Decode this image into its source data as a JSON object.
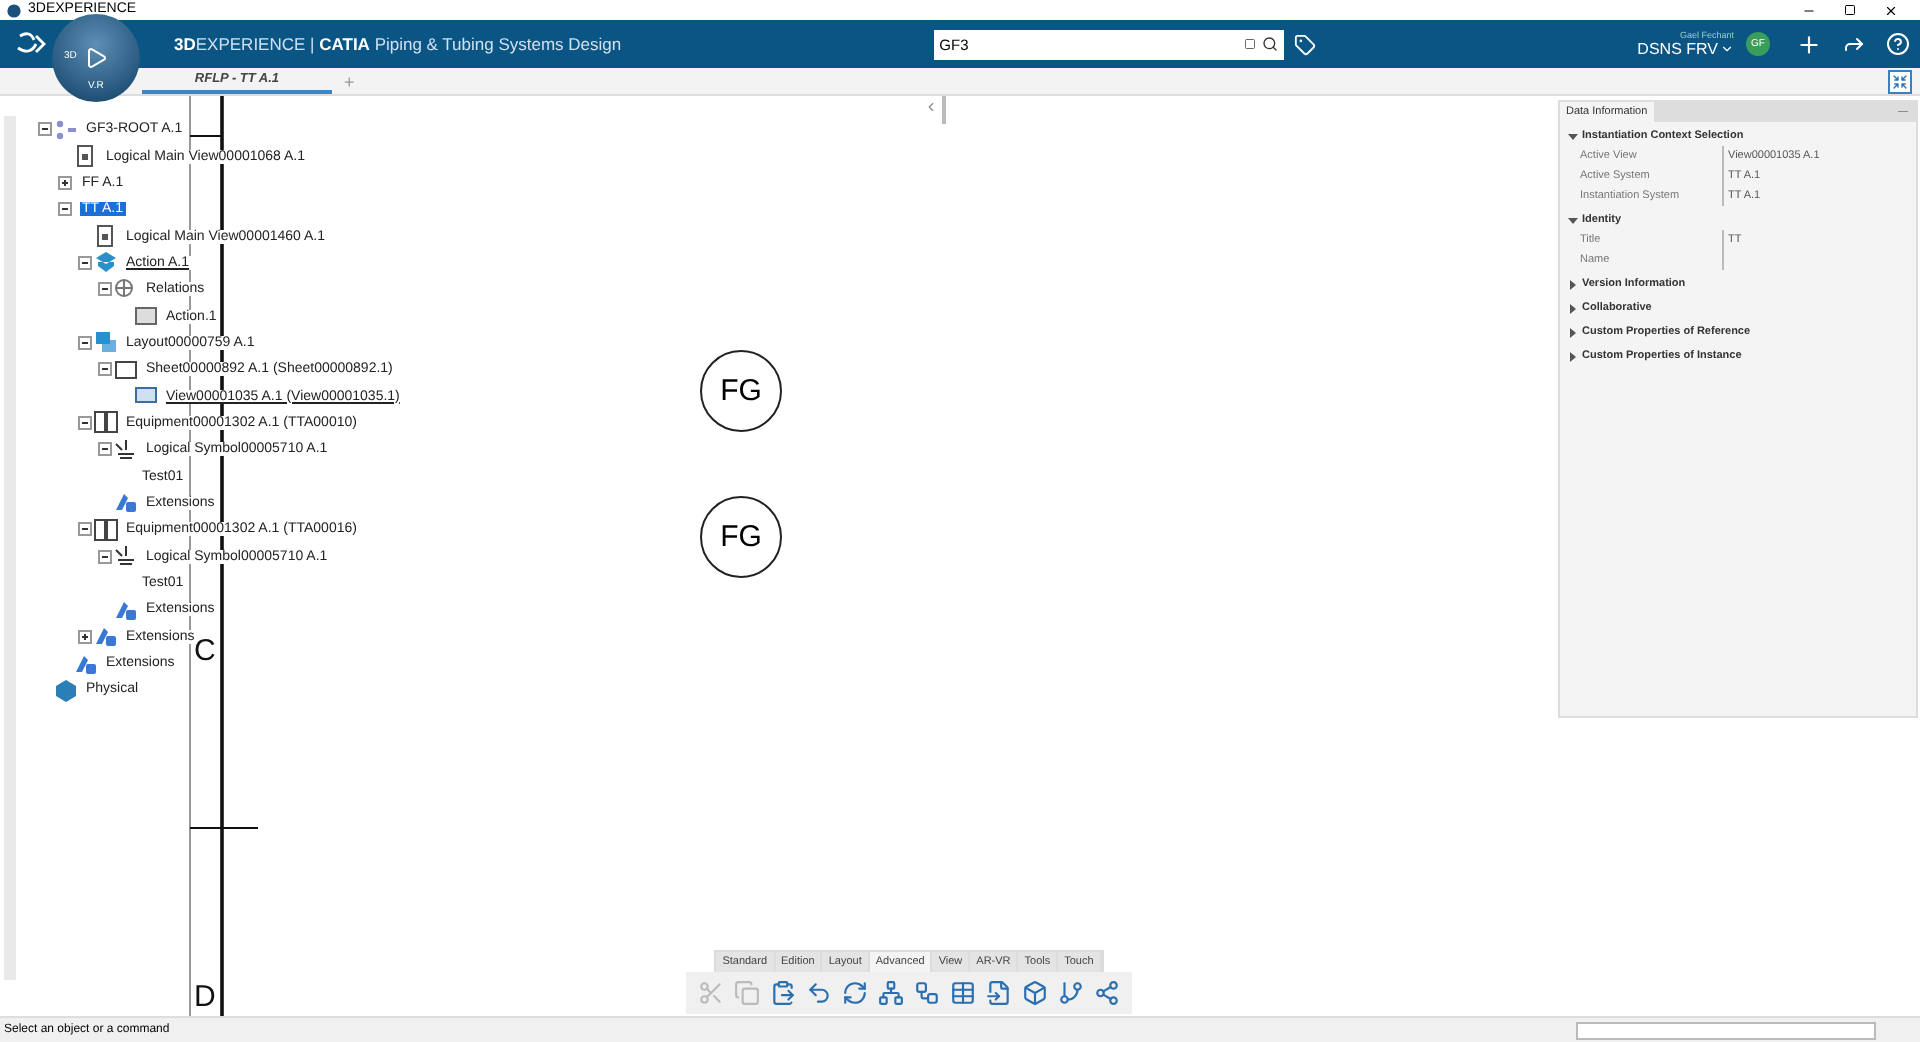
{
  "window": {
    "title": "3DEXPERIENCE"
  },
  "top_bar": {
    "compass": {
      "left": "3D",
      "bottom": "V.R"
    },
    "brand": "**3D**EXPERIENCE | **CATIA** Piping & Tubing Systems Design",
    "search": {
      "value": "GF3"
    },
    "user": {
      "name": "Gael Fechant",
      "tenant": "DSNS FRV",
      "initials": "GF"
    }
  },
  "tabs": [
    {
      "label": "RFLP - TT A.1",
      "selected": true
    }
  ],
  "add_tab": "+",
  "tree": [
    {
      "label": "GF3-ROOT A.1",
      "kind": "root",
      "selected": false,
      "underlined": false,
      "expanded": true,
      "children": [
        {
          "label": "Logical Main View00001068 A.1",
          "kind": "logical-view",
          "selected": false,
          "underlined": false
        },
        {
          "label": "FF A.1",
          "kind": "plain",
          "selected": false,
          "underlined": false,
          "expanded": false
        },
        {
          "label": "TT A.1",
          "kind": "plain",
          "selected": true,
          "underlined": false,
          "expanded": true,
          "children": [
            {
              "label": "Logical Main View00001460 A.1",
              "kind": "logical-view",
              "selected": false,
              "underlined": false
            },
            {
              "label": "Action A.1",
              "kind": "action",
              "selected": false,
              "underlined": true,
              "expanded": true,
              "children": [
                {
                  "label": "Relations",
                  "kind": "relations",
                  "selected": false,
                  "underlined": false,
                  "expanded": true,
                  "children": [
                    {
                      "label": "Action.1",
                      "kind": "action-item",
                      "selected": false,
                      "underlined": false
                    }
                  ]
                }
              ]
            },
            {
              "label": "Layout00000759 A.1",
              "kind": "layout",
              "selected": false,
              "underlined": false,
              "expanded": true,
              "children": [
                {
                  "label": "Sheet00000892 A.1 (Sheet00000892.1)",
                  "kind": "sheet",
                  "selected": false,
                  "underlined": false,
                  "expanded": true,
                  "children": [
                    {
                      "label": "View00001035 A.1 (View00001035.1)",
                      "kind": "view",
                      "selected": false,
                      "underlined": true
                    }
                  ]
                }
              ]
            },
            {
              "label": "Equipment00001302 A.1 (TTA00010)",
              "kind": "equipment",
              "selected": false,
              "underlined": false,
              "expanded": true,
              "children": [
                {
                  "label": "Logical Symbol00005710 A.1",
                  "kind": "symbol",
                  "selected": false,
                  "underlined": false,
                  "expanded": true,
                  "children": [
                    {
                      "label": "Test01",
                      "kind": "plain",
                      "selected": false,
                      "underlined": false
                    }
                  ]
                },
                {
                  "label": "Extensions",
                  "kind": "extensions",
                  "selected": false,
                  "underlined": false
                }
              ]
            },
            {
              "label": "Equipment00001302 A.1 (TTA00016)",
              "kind": "equipment",
              "selected": false,
              "underlined": false,
              "expanded": true,
              "children": [
                {
                  "label": "Logical Symbol00005710 A.1",
                  "kind": "symbol",
                  "selected": false,
                  "underlined": false,
                  "expanded": true,
                  "children": [
                    {
                      "label": "Test01",
                      "kind": "plain",
                      "selected": false,
                      "underlined": false
                    }
                  ]
                },
                {
                  "label": "Extensions",
                  "kind": "extensions",
                  "selected": false,
                  "underlined": false
                }
              ]
            },
            {
              "label": "Extensions",
              "kind": "extensions",
              "selected": false,
              "underlined": false,
              "expanded": false
            }
          ]
        },
        {
          "label": "Extensions",
          "kind": "extensions",
          "selected": false,
          "underlined": false
        }
      ]
    },
    {
      "label": "Physical",
      "kind": "physical",
      "selected": false,
      "underlined": false
    }
  ],
  "canvas": {
    "letters": [
      "C",
      "D"
    ],
    "symbols": [
      "FG",
      "FG"
    ]
  },
  "data_panel": {
    "title": "Data Information",
    "minimize": "—",
    "sections": [
      {
        "title": "Instantiation Context Selection",
        "expanded": true,
        "rows": [
          {
            "label": "Active View",
            "value": "View00001035 A.1"
          },
          {
            "label": "Active System",
            "value": "TT A.1"
          },
          {
            "label": "Instantiation System",
            "value": "TT A.1"
          }
        ]
      },
      {
        "title": "Identity",
        "expanded": true,
        "rows": [
          {
            "label": "Title",
            "value": "TT"
          },
          {
            "label": "Name"
          }
        ]
      },
      {
        "title": "Version Information",
        "expanded": false
      },
      {
        "title": "Collaborative",
        "expanded": false
      },
      {
        "title": "Custom Properties of Reference",
        "expanded": false
      },
      {
        "title": "Custom Properties of Instance",
        "expanded": false
      }
    ]
  },
  "action_bar": {
    "tabs": [
      {
        "label": "Standard",
        "selected": false
      },
      {
        "label": "Edition",
        "selected": false
      },
      {
        "label": "Layout",
        "selected": false
      },
      {
        "label": "Advanced",
        "selected": true
      },
      {
        "label": "View",
        "selected": false
      },
      {
        "label": "AR-VR",
        "selected": false
      },
      {
        "label": "Tools",
        "selected": false
      },
      {
        "label": "Touch",
        "selected": false
      }
    ],
    "buttons": [
      {
        "kind": "cut",
        "disabled": true
      },
      {
        "kind": "copy",
        "disabled": true
      },
      {
        "kind": "paste",
        "disabled": false
      },
      {
        "kind": "undo",
        "disabled": false
      },
      {
        "kind": "update",
        "disabled": false
      },
      {
        "kind": "hierarchy",
        "disabled": false
      },
      {
        "kind": "network",
        "disabled": false
      },
      {
        "kind": "table",
        "disabled": false
      },
      {
        "kind": "import",
        "disabled": false
      },
      {
        "kind": "component",
        "disabled": false
      },
      {
        "kind": "flow",
        "disabled": false
      },
      {
        "kind": "graph",
        "disabled": false
      }
    ]
  },
  "status_bar": {
    "message": "Select an object or a command"
  }
}
